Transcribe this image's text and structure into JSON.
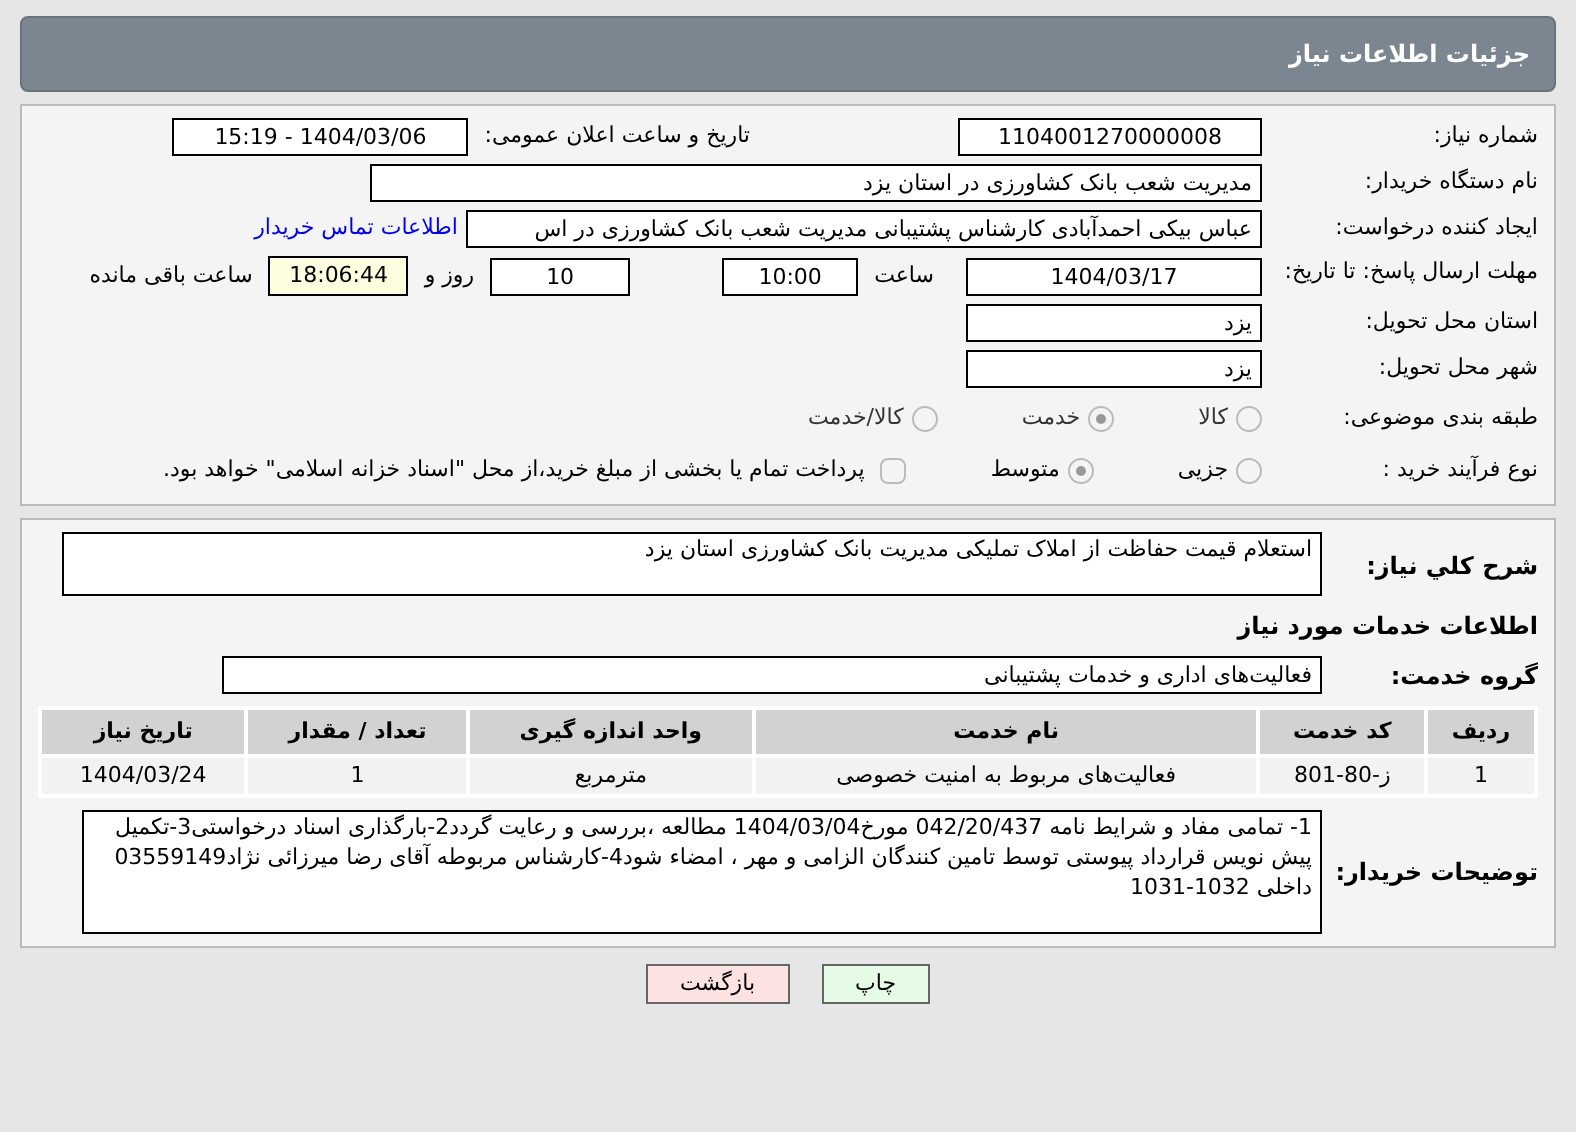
{
  "header": {
    "title": "جزئیات اطلاعات نیاز"
  },
  "need_number": {
    "label": "شماره نیاز:",
    "value": "1104001270000008"
  },
  "announce": {
    "label": "تاریخ و ساعت اعلان عمومی:",
    "value": "1404/03/06 - 15:19"
  },
  "buyer_org": {
    "label": "نام دستگاه خریدار:",
    "value": "مدیریت شعب بانک کشاورزی در استان یزد"
  },
  "requester": {
    "label": "ایجاد کننده درخواست:",
    "value": "عباس بیکی احمدآبادی کارشناس پشتیبانی مدیریت شعب بانک کشاورزی در اس",
    "link": "اطلاعات تماس خریدار"
  },
  "deadline": {
    "label": "مهلت ارسال پاسخ: تا تاریخ:",
    "date": "1404/03/17",
    "time_label": "ساعت",
    "time": "10:00",
    "days": "10",
    "days_label": "روز و",
    "remaining": "18:06:44",
    "remaining_label": "ساعت باقی مانده"
  },
  "province": {
    "label": "استان محل تحویل:",
    "value": "یزد"
  },
  "city": {
    "label": "شهر محل تحویل:",
    "value": "یزد"
  },
  "category": {
    "label": "طبقه بندی موضوعی:",
    "options": [
      {
        "label": "کالا",
        "selected": false
      },
      {
        "label": "خدمت",
        "selected": true
      },
      {
        "label": "کالا/خدمت",
        "selected": false
      }
    ]
  },
  "process": {
    "label": "نوع فرآیند خرید :",
    "options": [
      {
        "label": "جزیی",
        "selected": false
      },
      {
        "label": "متوسط",
        "selected": true
      }
    ],
    "payment": {
      "checked": false,
      "text": "پرداخت تمام یا بخشی از مبلغ خرید،از محل \"اسناد خزانه اسلامی\" خواهد بود."
    }
  },
  "description": {
    "label": "شرح کلي نياز:",
    "value": "استعلام قیمت حفاظت از املاک تملیکی مدیریت بانک کشاورزی استان یزد"
  },
  "services_title": "اطلاعات خدمات مورد نیاز",
  "service_group": {
    "label": "گروه خدمت:",
    "value": "فعالیت‌های اداری و خدمات پشتیبانی"
  },
  "table": {
    "columns": [
      "ردیف",
      "کد خدمت",
      "نام خدمت",
      "واحد اندازه گیری",
      "تعداد / مقدار",
      "تاریخ نیاز"
    ],
    "rows": [
      [
        "1",
        "ز-80-801",
        "فعالیت‌های مربوط به امنیت خصوصی",
        "مترمربع",
        "1",
        "1404/03/24"
      ]
    ]
  },
  "buyer_notes": {
    "label": "توضیحات خریدار:",
    "value": "1- تمامی مفاد و شرایط نامه 042/20/437 مورخ1404/03/04 مطالعه ،بررسی و رعایت گردد2-بارگذاری اسناد درخواستی3-تکمیل پیش نویس قرارداد پیوستی توسط تامین کنندگان الزامی و مهر ، امضاء شود4-کارشناس مربوطه آقای رضا میرزائی نژاد03559149  داخلی 1032-1031"
  },
  "buttons": [
    {
      "label": "چاپ",
      "kind": "print"
    },
    {
      "label": "بازگشت",
      "kind": "back"
    }
  ]
}
